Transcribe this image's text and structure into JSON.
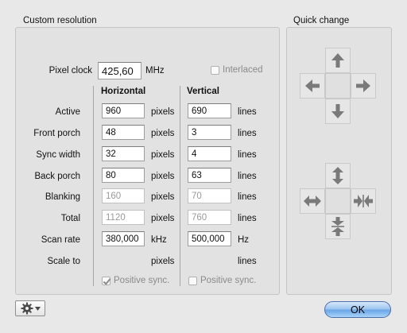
{
  "custom_resolution": {
    "title": "Custom resolution",
    "pixel_clock": {
      "label": "Pixel clock",
      "value": "425,60",
      "unit": "MHz"
    },
    "interlaced": {
      "label": "Interlaced",
      "checked": false,
      "enabled": false
    },
    "columns": {
      "horizontal": "Horizontal",
      "vertical": "Vertical"
    },
    "rows": [
      {
        "label": "Active",
        "h": "960",
        "h_unit": "pixels",
        "v": "690",
        "v_unit": "lines",
        "editable": true
      },
      {
        "label": "Front porch",
        "h": "48",
        "h_unit": "pixels",
        "v": "3",
        "v_unit": "lines",
        "editable": true
      },
      {
        "label": "Sync width",
        "h": "32",
        "h_unit": "pixels",
        "v": "4",
        "v_unit": "lines",
        "editable": true
      },
      {
        "label": "Back porch",
        "h": "80",
        "h_unit": "pixels",
        "v": "63",
        "v_unit": "lines",
        "editable": true
      },
      {
        "label": "Blanking",
        "h": "160",
        "h_unit": "pixels",
        "v": "70",
        "v_unit": "lines",
        "editable": false
      },
      {
        "label": "Total",
        "h": "1120",
        "h_unit": "pixels",
        "v": "760",
        "v_unit": "lines",
        "editable": false
      },
      {
        "label": "Scan rate",
        "h": "380,000",
        "h_unit": "kHz",
        "v": "500,000",
        "v_unit": "Hz",
        "editable": true
      },
      {
        "label": "Scale to",
        "h": "",
        "h_unit": "pixels",
        "v": "",
        "v_unit": "lines",
        "editable": false
      }
    ],
    "positive_sync_h": {
      "label": "Positive sync.",
      "checked": true,
      "enabled": false
    },
    "positive_sync_v": {
      "label": "Positive sync.",
      "checked": false,
      "enabled": false
    }
  },
  "quick_change": {
    "title": "Quick change",
    "move_icons": [
      "arrow-up-icon",
      "arrow-left-icon",
      "arrow-right-icon",
      "arrow-down-icon"
    ],
    "size_icons": [
      "expand-vertical-icon",
      "expand-horizontal-icon",
      "shrink-horizontal-icon",
      "shrink-vertical-icon"
    ]
  },
  "footer": {
    "action_menu_icon": "gear-icon",
    "ok_label": "OK"
  },
  "colors": {
    "ok_accent": "#6aa6e8",
    "arrow": "#7a7a7a"
  }
}
